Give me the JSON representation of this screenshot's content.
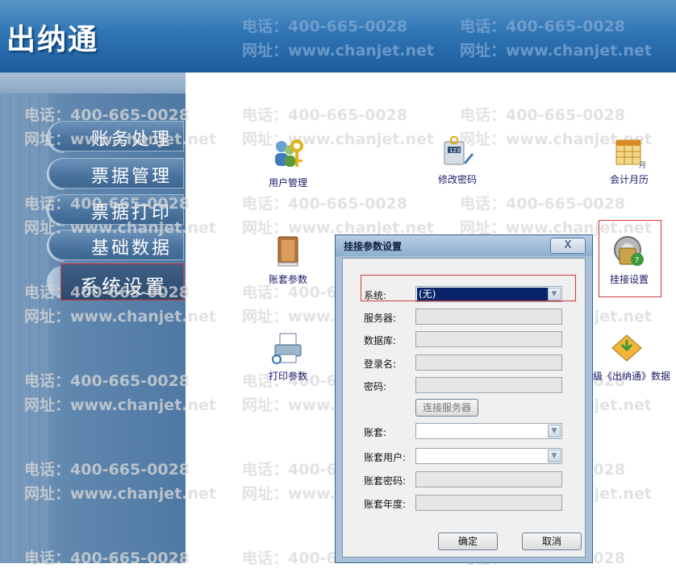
{
  "app": {
    "title": "出纳通"
  },
  "watermark": {
    "phone": "电话：400-665-0028",
    "site": "网址：www.chanjet.net"
  },
  "sidebar": {
    "items": [
      {
        "label": "账务处理"
      },
      {
        "label": "票据管理"
      },
      {
        "label": "票据打印"
      },
      {
        "label": "基础数据"
      },
      {
        "label": "系统设置",
        "active": true
      }
    ]
  },
  "tiles": [
    {
      "label": "用户管理",
      "icon": "user-key-icon"
    },
    {
      "label": "修改密码",
      "icon": "password-icon"
    },
    {
      "label": "会计月历",
      "icon": "calendar-icon"
    },
    {
      "label": "账套参数",
      "icon": "book-icon"
    },
    {
      "label": "挂接设置",
      "icon": "link-settings-icon"
    },
    {
      "label": "打印参数",
      "icon": "printer-icon"
    },
    {
      "label": "级《出纳通》数据",
      "icon": "upgrade-icon"
    }
  ],
  "dialog": {
    "title": "挂接参数设置",
    "close_label": "X",
    "fields": {
      "system": {
        "label": "系统:",
        "value": "(无)"
      },
      "server": {
        "label": "服务器:"
      },
      "database": {
        "label": "数据库:"
      },
      "login": {
        "label": "登录名:"
      },
      "password": {
        "label": "密码:"
      },
      "account_set": {
        "label": "账套:"
      },
      "account_user": {
        "label": "账套用户:"
      },
      "account_password": {
        "label": "账套密码:"
      },
      "account_year": {
        "label": "账套年度:"
      }
    },
    "connect_label": "连接服务器",
    "ok_label": "确定",
    "cancel_label": "取消"
  },
  "colors": {
    "header": "#2f74b4",
    "sidebar": "#5f86ad",
    "highlight": "#d03a3a",
    "selection": "#0a246a"
  }
}
